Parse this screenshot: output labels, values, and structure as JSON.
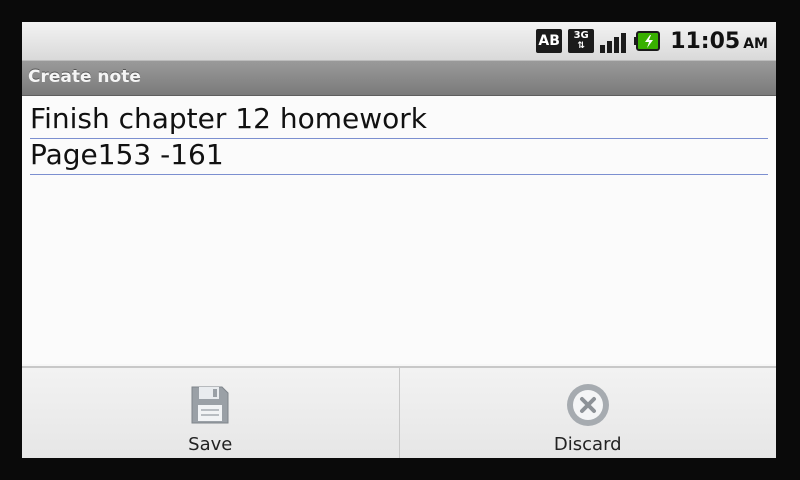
{
  "status_bar": {
    "ab_label": "AB",
    "network_label": "3G",
    "time": "11:05",
    "ampm": "AM"
  },
  "titlebar": {
    "title": "Create note"
  },
  "note": {
    "lines": [
      "Finish chapter 12 homework",
      "Page153 -161"
    ]
  },
  "menu": {
    "items": [
      {
        "label": "Save",
        "icon": "save-icon"
      },
      {
        "label": "Discard",
        "icon": "discard-icon"
      }
    ]
  },
  "colors": {
    "title_bar": "#8a8a8a",
    "note_rule": "#7c8fd0",
    "battery": "#38b000"
  }
}
